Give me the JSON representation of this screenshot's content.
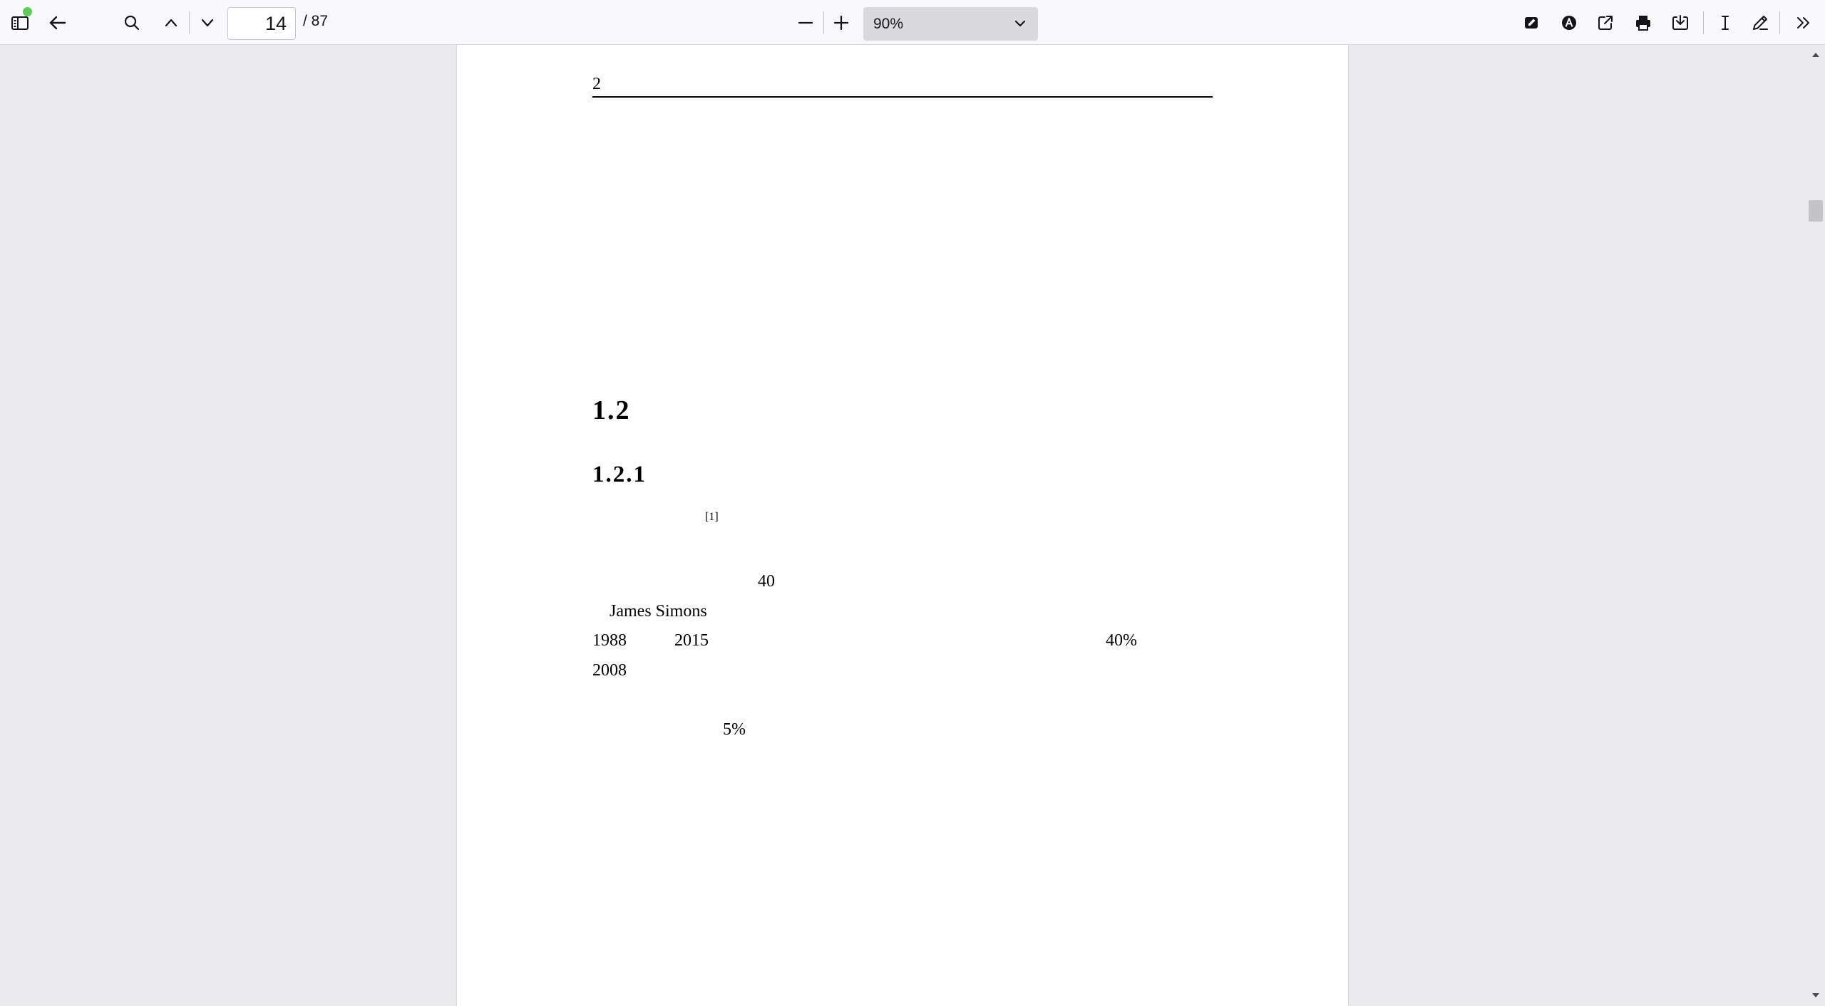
{
  "toolbar": {
    "page_number": "14",
    "page_total": "/ 87",
    "zoom_value": "90%",
    "icons": {
      "sidebar": "sidebar-toggle-icon",
      "back": "back-arrow-icon",
      "find": "search-icon",
      "prev": "chevron-up-icon",
      "next": "chevron-down-icon",
      "zoom_out": "minus-icon",
      "zoom_in": "plus-icon",
      "edit": "edit-pencil-icon",
      "text": "text-a-icon",
      "open": "external-link-icon",
      "print": "print-icon",
      "save": "download-icon",
      "cursor": "text-cursor-icon",
      "draw": "draw-pencil-icon",
      "more": "double-chevron-icon"
    },
    "notification_color": "#5bcf4f"
  },
  "document": {
    "header_page_number": "2",
    "section_heading": "1.2",
    "subsection_heading": "1.2.1",
    "citation": "[1]",
    "text_40": "40",
    "name": "James Simons",
    "year_1988": "1988",
    "year_2015": "2015",
    "percent_40": "40%",
    "year_2008": "2008",
    "percent_5": "5%"
  }
}
